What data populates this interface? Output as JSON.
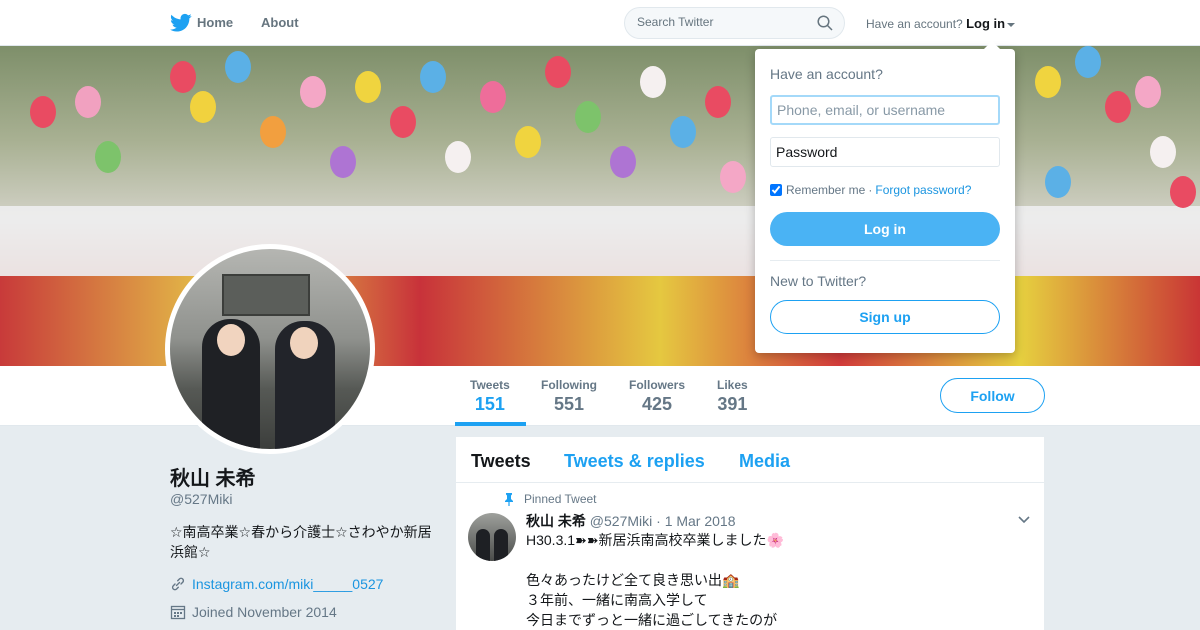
{
  "nav": {
    "home_label": "Home",
    "about_label": "About",
    "search_placeholder": "Search Twitter",
    "have_account": "Have an account?",
    "login_label": "Log in"
  },
  "profile": {
    "name": "秋山 未希",
    "handle": "@527Miki",
    "bio": "☆南高卒業☆春から介護士☆さわやか新居浜館☆",
    "link": "Instagram.com/miki_____0527",
    "joined": "Joined November 2014",
    "follow_label": "Follow"
  },
  "stats": [
    {
      "label": "Tweets",
      "value": "151"
    },
    {
      "label": "Following",
      "value": "551"
    },
    {
      "label": "Followers",
      "value": "425"
    },
    {
      "label": "Likes",
      "value": "391"
    }
  ],
  "timeline": {
    "tabs": [
      "Tweets",
      "Tweets & replies",
      "Media"
    ],
    "pinned_label": "Pinned Tweet",
    "tweet": {
      "name": "秋山 未希",
      "handle": "@527Miki",
      "date": "1 Mar 2018",
      "line1": "H30.3.1➽➽新居浜南高校卒業しました🌸",
      "line2": "色々あったけど全て良き思い出🏫",
      "line3": "３年前、一緒に南高入学して",
      "line4": "今日までずっと一緒に過ごしてきたのが"
    }
  },
  "login_dropdown": {
    "title": "Have an account?",
    "username_placeholder": "Phone, email, or username",
    "password_placeholder": "Password",
    "remember_label": "Remember me",
    "separator": "·",
    "forgot_label": "Forgot password?",
    "login_button": "Log in",
    "new_label": "New to Twitter?",
    "signup_button": "Sign up"
  },
  "colors": {
    "accent": "#1da1f2",
    "login_button": "#4ab3f4",
    "background": "#e6ecf0",
    "muted": "#657786"
  },
  "icons": [
    "twitter-bird-icon",
    "search-icon",
    "link-icon",
    "calendar-icon",
    "pin-icon",
    "chevron-down-icon",
    "checkbox-icon"
  ]
}
